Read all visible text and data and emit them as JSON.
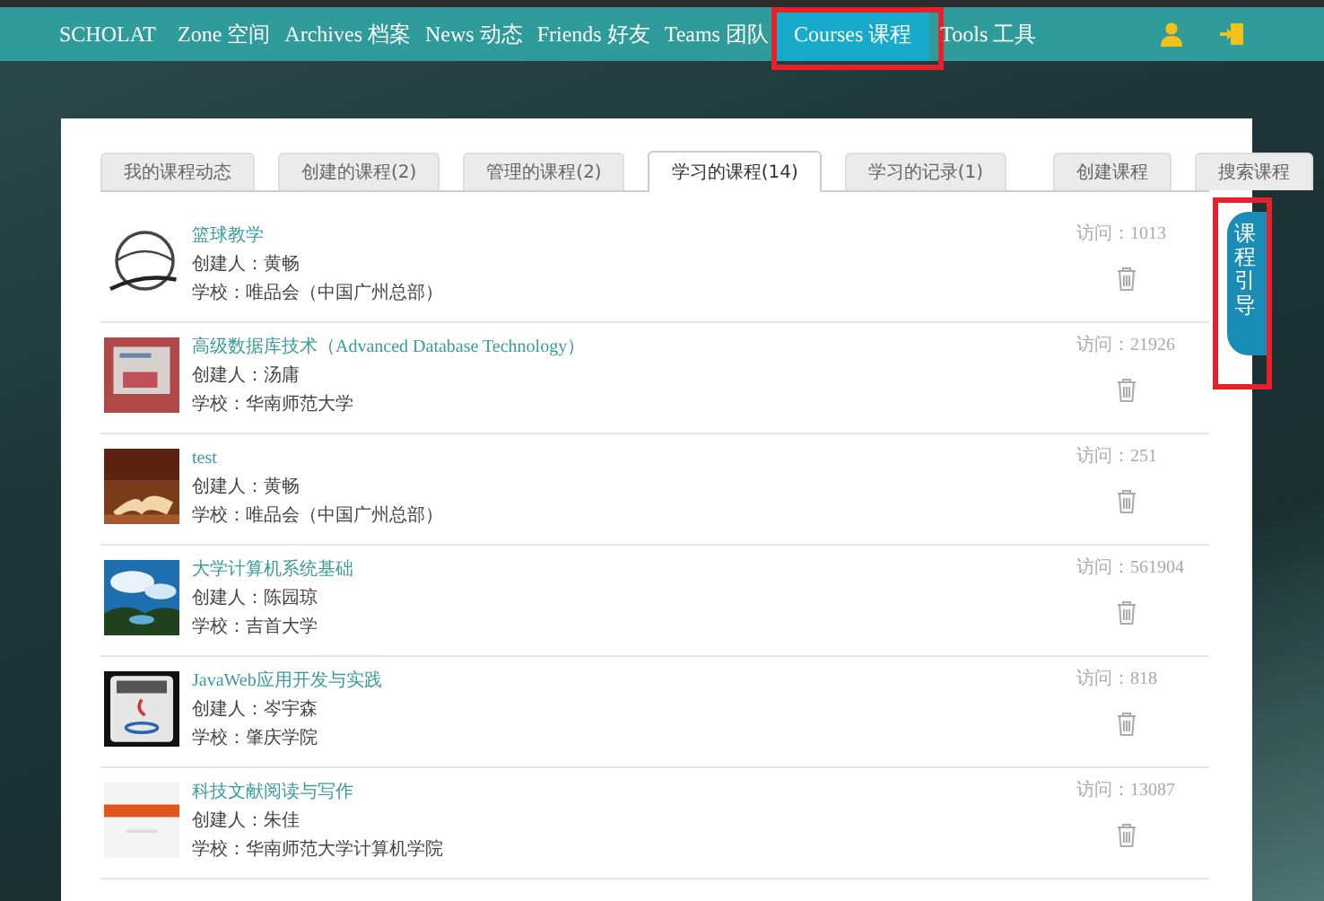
{
  "nav": {
    "brand": "SCHOLAT",
    "items": [
      {
        "label": "Zone 空间",
        "selected": false
      },
      {
        "label": "Archives 档案",
        "selected": false
      },
      {
        "label": "News 动态",
        "selected": false
      },
      {
        "label": "Friends 好友",
        "selected": false
      },
      {
        "label": "Teams 团队",
        "selected": false
      },
      {
        "label": "Courses 课程",
        "selected": true
      },
      {
        "label": "Tools 工具",
        "selected": false
      }
    ]
  },
  "tabs": [
    {
      "label": "我的课程动态",
      "selected": false
    },
    {
      "label": "创建的课程(2)",
      "selected": false
    },
    {
      "label": "管理的课程(2)",
      "selected": false
    },
    {
      "label": "学习的课程(14)",
      "selected": true
    },
    {
      "label": "学习的记录(1)",
      "selected": false
    }
  ],
  "actions": [
    "创建课程",
    "搜索课程"
  ],
  "courses": [
    {
      "title": "篮球教学",
      "creator": "创建人：黄畅",
      "school": "学校：唯品会（中国广州总部）",
      "visits": "访问：1013"
    },
    {
      "title": "高级数据库技术（Advanced Database Technology）",
      "creator": "创建人：汤庸",
      "school": "学校：华南师范大学",
      "visits": "访问：21926"
    },
    {
      "title": "test",
      "creator": "创建人：黄畅",
      "school": "学校：唯品会（中国广州总部）",
      "visits": "访问：251"
    },
    {
      "title": "大学计算机系统基础",
      "creator": "创建人：陈园琼",
      "school": "学校：吉首大学",
      "visits": "访问：561904"
    },
    {
      "title": "JavaWeb应用开发与实践",
      "creator": "创建人：岑宇森",
      "school": "学校：肇庆学院",
      "visits": "访问：818"
    },
    {
      "title": "科技文献阅读与写作",
      "creator": "创建人：朱佳",
      "school": "学校：华南师范大学计算机学院",
      "visits": "访问：13087"
    }
  ],
  "side_tab": {
    "label": "课程引导"
  }
}
